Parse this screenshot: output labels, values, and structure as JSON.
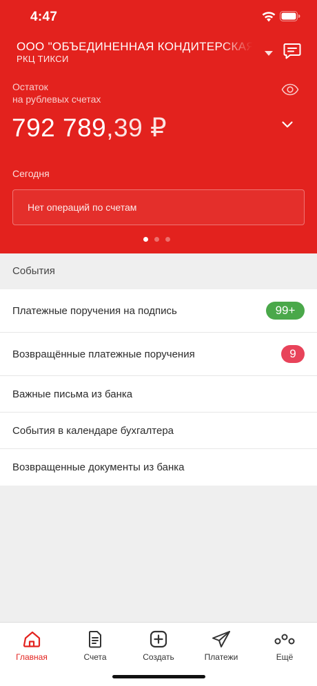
{
  "status_bar": {
    "time": "4:47"
  },
  "header": {
    "company": "ООО \"ОБЪЕДИНЕННАЯ КОНДИТЕРСКАЯ СЕТЬ\"",
    "branch": "РКЦ ТИКСИ"
  },
  "balance": {
    "label_line1": "Остаток",
    "label_line2": "на рублевых счетах",
    "integer": "792 789",
    "fraction": ",39 ₽"
  },
  "today": {
    "label": "Сегодня",
    "empty_text": "Нет операций по счетам"
  },
  "carousel": {
    "page": 1,
    "pages": 3
  },
  "events": {
    "title": "События",
    "items": [
      {
        "label": "Платежные поручения на подпись",
        "badge": "99+",
        "badge_color": "#4aa84a"
      },
      {
        "label": "Возвращённые платежные поручения",
        "badge": "9",
        "badge_color": "#e8435a"
      },
      {
        "label": "Важные письма из банка"
      },
      {
        "label": "События в календаре бухгалтера"
      },
      {
        "label": "Возвращенные документы из банка"
      }
    ]
  },
  "tabs": [
    {
      "label": "Главная",
      "icon": "home-icon",
      "active": true
    },
    {
      "label": "Счета",
      "icon": "document-icon"
    },
    {
      "label": "Создать",
      "icon": "plus-square-icon"
    },
    {
      "label": "Платежи",
      "icon": "paper-plane-icon"
    },
    {
      "label": "Ещё",
      "icon": "more-dots-icon"
    }
  ],
  "colors": {
    "accent": "#e3221e",
    "active_tab": "#e3221e"
  }
}
